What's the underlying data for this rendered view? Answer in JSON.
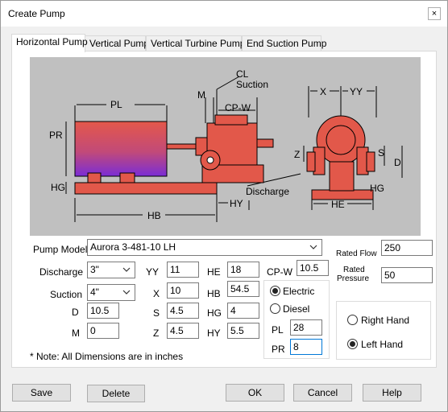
{
  "window": {
    "title": "Create Pump",
    "close_glyph": "×"
  },
  "tabs": [
    "Horizontal Pump",
    "Vertical Pump",
    "Vertical Turbine Pump",
    "End Suction Pump"
  ],
  "diagram_labels": {
    "pl": "PL",
    "pr": "PR",
    "hg_left": "HG",
    "hb": "HB",
    "m": "M",
    "cl": "CL",
    "suction": "Suction",
    "cpw": "CP-W",
    "hy": "HY",
    "x": "X",
    "yy": "YY",
    "z": "Z",
    "s": "S",
    "d": "D",
    "discharge": "Discharge",
    "hg_right": "HG",
    "he": "HE"
  },
  "form": {
    "pump_model_label": "Pump Model",
    "pump_model_value": "Aurora 3-481-10  LH",
    "discharge_label": "Discharge",
    "discharge_value": "3\"",
    "suction_label": "Suction",
    "suction_value": "4\"",
    "d_label": "D",
    "d_value": "10.5",
    "m_label": "M",
    "m_value": "0",
    "yy_label": "YY",
    "yy_value": "11",
    "x_label": "X",
    "x_value": "10",
    "s_label": "S",
    "s_value": "4.5",
    "z_label": "Z",
    "z_value": "4.5",
    "he_label": "HE",
    "he_value": "18",
    "hb_label": "HB",
    "hb_value": "54.5",
    "hg_label": "HG",
    "hg_value": "4",
    "hy_label": "HY",
    "hy_value": "5.5",
    "cpw_label": "CP-W",
    "cpw_value": "10.5",
    "electric_label": "Electric",
    "diesel_label": "Diesel",
    "pl_label": "PL",
    "pl_value": "28",
    "pr_label": "PR",
    "pr_value": "8",
    "rated_flow_label": "Rated Flow",
    "rated_flow_value": "250",
    "rated_pressure_label_1": "Rated",
    "rated_pressure_label_2": "Pressure",
    "rated_pressure_value": "50",
    "right_hand_label": "Right Hand",
    "left_hand_label": "Left Hand",
    "note": "* Note: All Dimensions are in inches"
  },
  "buttons": {
    "save": "Save",
    "delete": "Delete",
    "ok": "OK",
    "cancel": "Cancel",
    "help": "Help"
  },
  "colors": {
    "pump_body": "#e2584a",
    "motor_gradient_top": "#e2584a",
    "motor_gradient_bottom": "#7a2dd6",
    "diagram_bg": "#c0c0c0"
  }
}
